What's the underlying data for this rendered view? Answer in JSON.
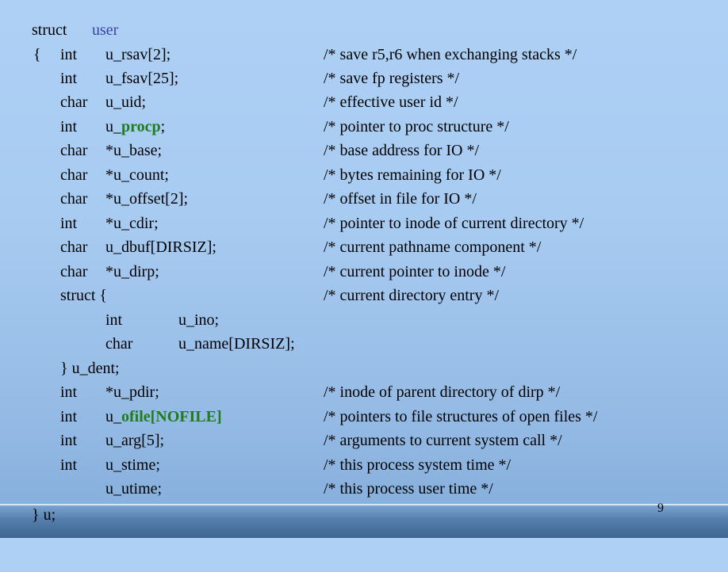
{
  "header": {
    "keyword": "struct",
    "name": "user"
  },
  "lines": [
    {
      "brace": "{",
      "type": "int",
      "decl": "u_rsav[2];",
      "comment": "/* save r5,r6 when exchanging stacks */"
    },
    {
      "type": "int",
      "decl": "u_fsav[25];",
      "comment": "/* save fp registers */"
    },
    {
      "type": "char",
      "decl": "u_uid;",
      "comment": "/* effective user id */"
    },
    {
      "type": "int",
      "decl_prefix": "u_",
      "decl_hl": "procp",
      "decl_suffix": ";",
      "comment": "/* pointer to proc structure */"
    },
    {
      "type": "char",
      "decl": "*u_base;",
      "comment": "/* base address for IO */"
    },
    {
      "type": "char",
      "decl": "*u_count;",
      "comment": "/* bytes remaining for IO */"
    },
    {
      "type": "char",
      "decl": "*u_offset[2];",
      "comment": "/* offset in file for IO */"
    },
    {
      "type": "int",
      "decl": "*u_cdir;",
      "comment": "/* pointer to inode of current directory */"
    },
    {
      "type": "char",
      "decl": "u_dbuf[DIRSIZ];",
      "comment": "/* current pathname component */"
    },
    {
      "type": "char",
      "decl": "*u_dirp;",
      "comment": "/* current pointer to inode */"
    },
    {
      "type": "struct {",
      "comment": "/* current directory entry */"
    },
    {
      "inner_type": "int",
      "inner_decl": "u_ino;"
    },
    {
      "inner_type": "char",
      "inner_decl": "u_name[DIRSIZ];"
    },
    {
      "type": "} u_dent;"
    },
    {
      "type": "int",
      "decl": "*u_pdir;",
      "comment": "/* inode of parent directory of dirp */"
    },
    {
      "type": "int",
      "decl_prefix": "u_",
      "decl_hl": "ofile[NOFILE]",
      "decl_suffix": "",
      "comment": "/* pointers to file structures of open files */"
    },
    {
      "type": "int",
      "decl": "u_arg[5];",
      "comment": "/* arguments to current system call */"
    },
    {
      "type": "int",
      "decl": "u_stime;",
      "comment": "/* this process system time */"
    },
    {
      "decl": "u_utime;",
      "comment": "/* this process user time */"
    }
  ],
  "closing": "} u;",
  "page_number": "9",
  "colors": {
    "struct_name": "#3a44a8",
    "highlight": "#1f7d1f"
  }
}
